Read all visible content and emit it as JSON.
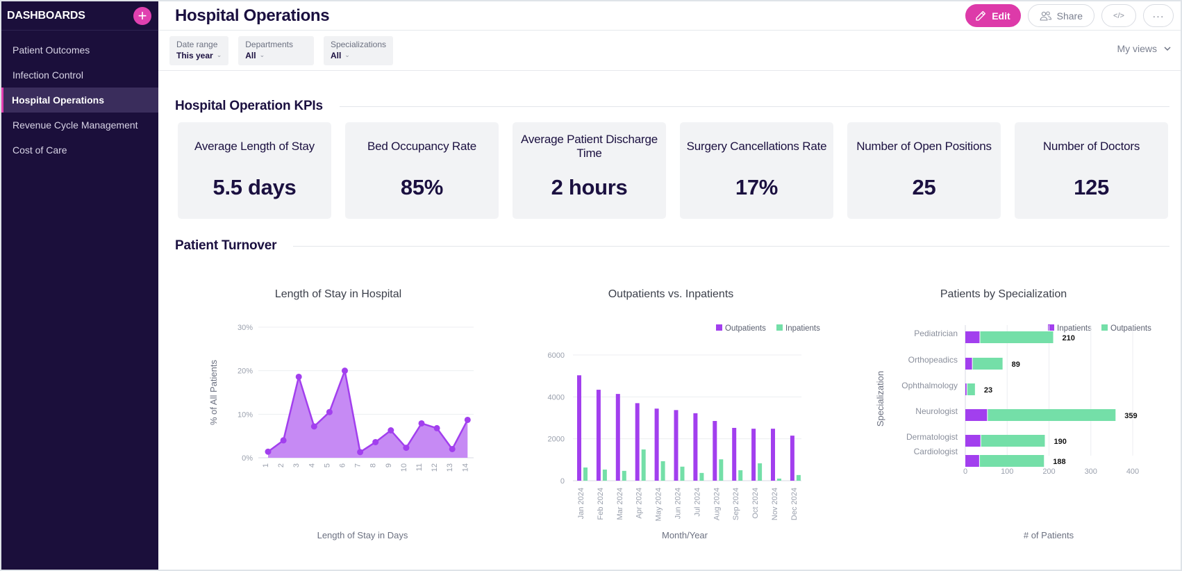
{
  "sidebar": {
    "title": "DASHBOARDS",
    "add_icon": "plus-icon",
    "items": [
      {
        "label": "Patient Outcomes",
        "active": false
      },
      {
        "label": "Infection Control",
        "active": false
      },
      {
        "label": "Hospital Operations",
        "active": true
      },
      {
        "label": "Revenue Cycle Management",
        "active": false
      },
      {
        "label": "Cost of Care",
        "active": false
      }
    ]
  },
  "header": {
    "title": "Hospital Operations",
    "edit_label": "Edit",
    "share_label": "Share",
    "embed_icon": "code-icon",
    "more_icon": "ellipsis-icon",
    "accent_color": "#dd3aa9"
  },
  "filters": [
    {
      "label": "Date range",
      "value": "This year"
    },
    {
      "label": "Departments",
      "value": "All"
    },
    {
      "label": "Specializations",
      "value": "All"
    }
  ],
  "my_views_label": "My views",
  "kpi_section": {
    "title": "Hospital Operation KPIs",
    "cards": [
      {
        "label": "Average Length of Stay",
        "value": "5.5 days"
      },
      {
        "label": "Bed Occupancy Rate",
        "value": "85%"
      },
      {
        "label": "Average Patient Discharge Time",
        "value": "2 hours"
      },
      {
        "label": "Surgery Cancellations Rate",
        "value": "17%"
      },
      {
        "label": "Number of Open Positions",
        "value": "25"
      },
      {
        "label": "Number of Doctors",
        "value": "125"
      }
    ]
  },
  "turnover_section": {
    "title": "Patient Turnover"
  },
  "colors": {
    "purple": "#a23fee",
    "purple_fill": "#c68af4",
    "green": "#74dfa8"
  },
  "chart_data": [
    {
      "type": "area",
      "title": "Length of Stay in Hospital",
      "xlabel": "Length of Stay in Days",
      "ylabel": "% of All Patients",
      "x": [
        1,
        2,
        3,
        4,
        5,
        6,
        7,
        8,
        9,
        10,
        11,
        12,
        13,
        14
      ],
      "values": [
        1.4,
        4.0,
        18.6,
        7.2,
        10.5,
        20.0,
        1.3,
        3.6,
        6.3,
        2.3,
        7.9,
        6.8,
        2.0,
        8.7
      ],
      "ylim": [
        0,
        30
      ],
      "yticks": [
        0,
        10,
        20,
        30
      ],
      "ytick_labels": [
        "0%",
        "10%",
        "20%",
        "30%"
      ],
      "grid": true
    },
    {
      "type": "bar",
      "title": "Outpatients vs. Inpatients",
      "xlabel": "Month/Year",
      "ylabel": "",
      "categories": [
        "Jan 2024",
        "Feb 2024",
        "Mar 2024",
        "Apr 2024",
        "May 2024",
        "Jun 2024",
        "Jul 2024",
        "Aug 2024",
        "Sep 2024",
        "Oct 2024",
        "Nov 2024",
        "Dec 2024"
      ],
      "series": [
        {
          "name": "Outpatients",
          "values": [
            5030,
            4340,
            4140,
            3700,
            3440,
            3370,
            3220,
            2850,
            2520,
            2480,
            2480,
            2150
          ]
        },
        {
          "name": "Inpatients",
          "values": [
            630,
            530,
            470,
            1490,
            930,
            670,
            370,
            1020,
            500,
            830,
            100,
            270
          ]
        }
      ],
      "ylim": [
        0,
        6000
      ],
      "yticks": [
        0,
        2000,
        4000,
        6000
      ],
      "legend": "top-right",
      "grid": true
    },
    {
      "type": "bar",
      "orientation": "horizontal",
      "stacked": true,
      "title": "Patients by Specialization",
      "xlabel": "# of Patients",
      "ylabel": "Specialization",
      "categories": [
        "Pediatrician",
        "Orthopeadics",
        "Ophthalmology",
        "Neurologist",
        "Dermatologist",
        "Cardiologist"
      ],
      "series": [
        {
          "name": "Inpatients",
          "values": [
            34,
            16,
            3,
            52,
            36,
            33
          ]
        },
        {
          "name": "Outpatients",
          "values": [
            176,
            73,
            20,
            307,
            154,
            155
          ]
        }
      ],
      "totals": [
        210,
        89,
        23,
        359,
        190,
        188
      ],
      "xlim": [
        0,
        400
      ],
      "xticks": [
        0,
        100,
        200,
        300,
        400
      ],
      "legend": "top-right",
      "grid": true
    }
  ]
}
